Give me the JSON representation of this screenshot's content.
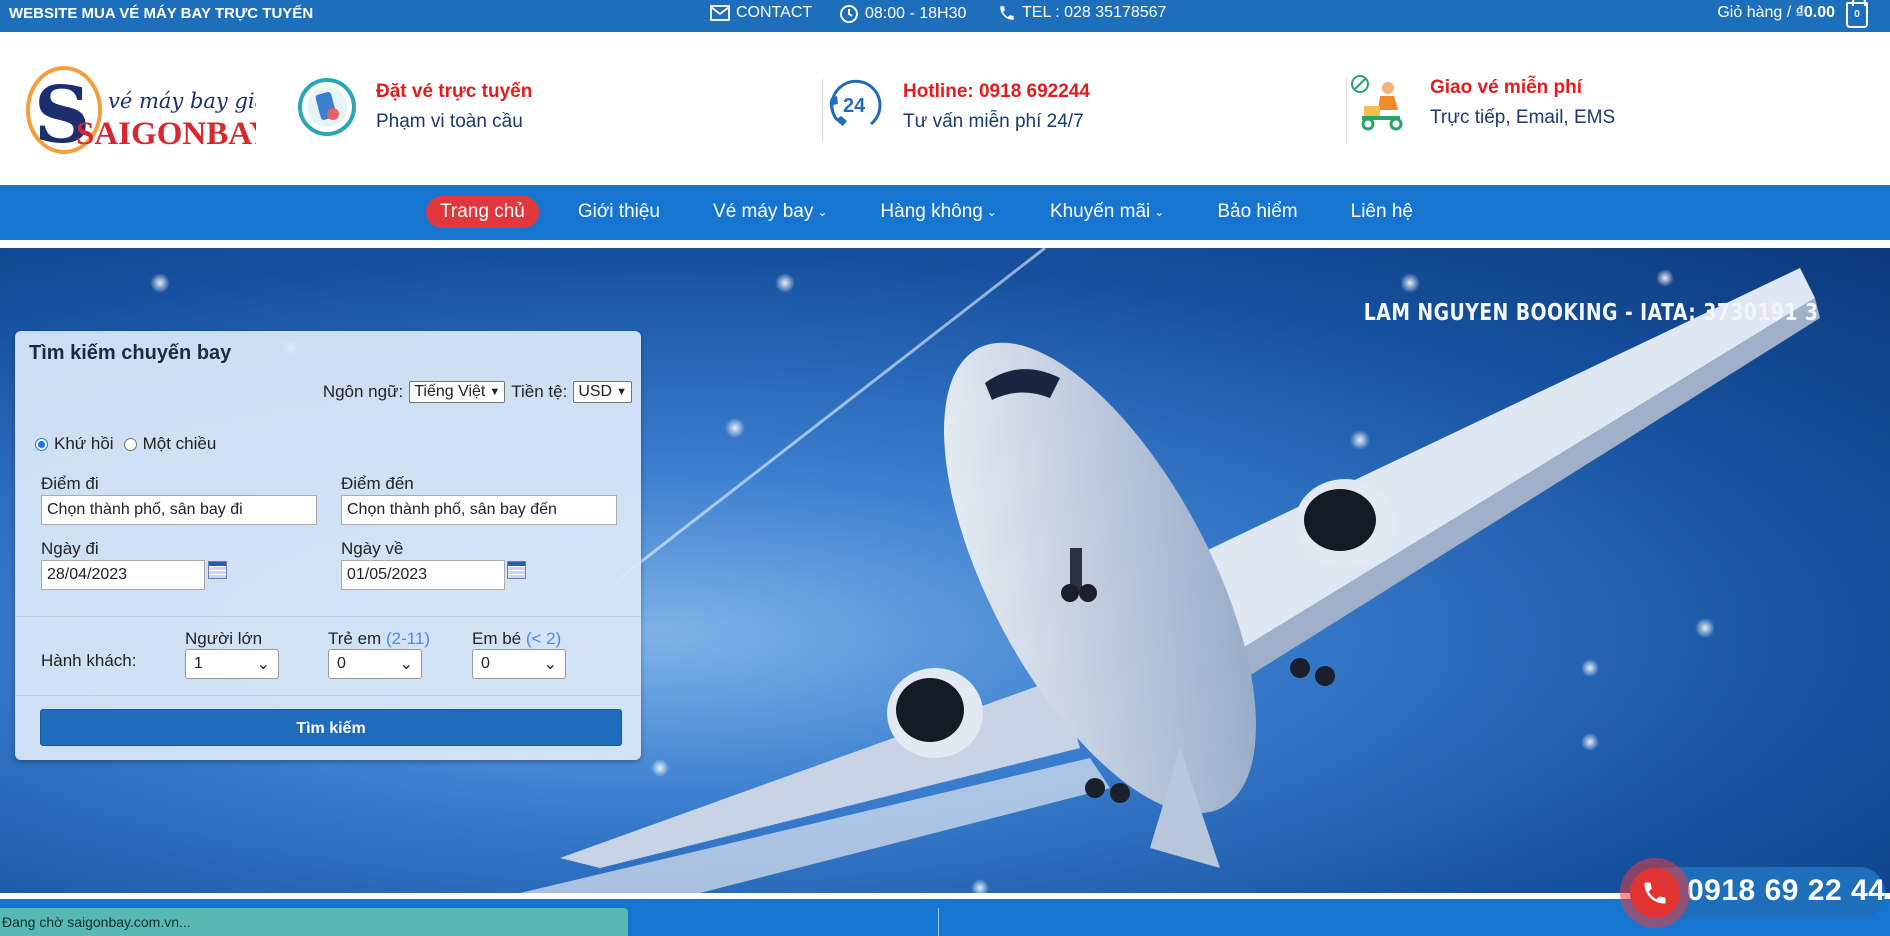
{
  "topbar": {
    "site_title": "WEBSITE MUA VÉ MÁY BAY TRỰC TUYẾN",
    "contact": "CONTACT",
    "hours": "08:00 - 18H30",
    "tel": "TEL : 028 35178567",
    "cart_label": "Giỏ hàng /",
    "cart_amount": "₫0.00",
    "cart_count": "0"
  },
  "header": {
    "logo_tagline": "vé máy bay giá rẻ",
    "logo_name": "SAIGONBAY",
    "features": [
      {
        "title": "Đặt vé trực tuyến",
        "subtitle": "Phạm vi toàn cầu"
      },
      {
        "title": "Hotline: 0918 692244",
        "subtitle": "Tư vấn miễn phí 24/7"
      },
      {
        "title": "Giao vé miễn phí",
        "subtitle": "Trực tiếp, Email, EMS"
      }
    ],
    "icon_24": "24"
  },
  "nav": {
    "items": [
      {
        "label": "Trang chủ"
      },
      {
        "label": "Giới thiệu"
      },
      {
        "label": "Vé máy bay"
      },
      {
        "label": "Hàng không"
      },
      {
        "label": "Khuyến mãi"
      },
      {
        "label": "Bảo hiểm"
      },
      {
        "label": "Liên hệ"
      }
    ]
  },
  "hero": {
    "iata": "LAM NGUYEN BOOKING - IATA: 3730191 3"
  },
  "search": {
    "title": "Tìm kiếm chuyến bay",
    "language_label": "Ngôn ngữ:",
    "language_value": "Tiếng Việt",
    "currency_label": "Tiền tệ:",
    "currency_value": "USD",
    "round_trip": "Khứ hồi",
    "one_way": "Một chiều",
    "from_label": "Điểm đi",
    "from_value": "Chọn thành phố, sân bay đi",
    "to_label": "Điểm đến",
    "to_value": "Chọn thành phố, sân bay đến",
    "depart_label": "Ngày đi",
    "depart_value": "28/04/2023",
    "return_label": "Ngày về",
    "return_value": "01/05/2023",
    "passengers_label": "Hành khách:",
    "adult_label": "Người lớn",
    "adult_value": "1",
    "child_label": "Trẻ em",
    "child_range": "(2-11)",
    "child_value": "0",
    "infant_label": "Em bé",
    "infant_range": "(< 2)",
    "infant_value": "0",
    "submit": "Tìm kiếm"
  },
  "phone": {
    "number": "0918 69 22 44"
  },
  "status_bar": "Đang chờ saigonbay.com.vn..."
}
